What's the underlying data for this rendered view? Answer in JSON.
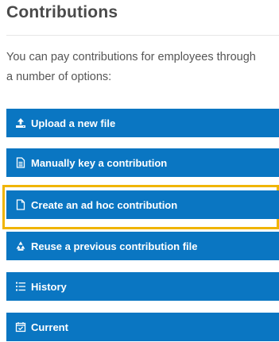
{
  "title": "Contributions",
  "intro": "You can pay contributions for employees through a number of options:",
  "buttons": [
    {
      "label": "Upload a new file",
      "icon": "upload-icon"
    },
    {
      "label": "Manually key a contribution",
      "icon": "document-text-icon"
    },
    {
      "label": "Create an ad hoc contribution",
      "icon": "document-icon",
      "selected": true
    },
    {
      "label": "Reuse a previous contribution file",
      "icon": "recycle-icon"
    },
    {
      "label": "History",
      "icon": "list-icon"
    },
    {
      "label": "Current",
      "icon": "calendar-check-icon"
    }
  ],
  "colors": {
    "button": "#0a76c2",
    "highlight": "#f0b400",
    "title": "#4a4a4a",
    "text": "#555555"
  }
}
